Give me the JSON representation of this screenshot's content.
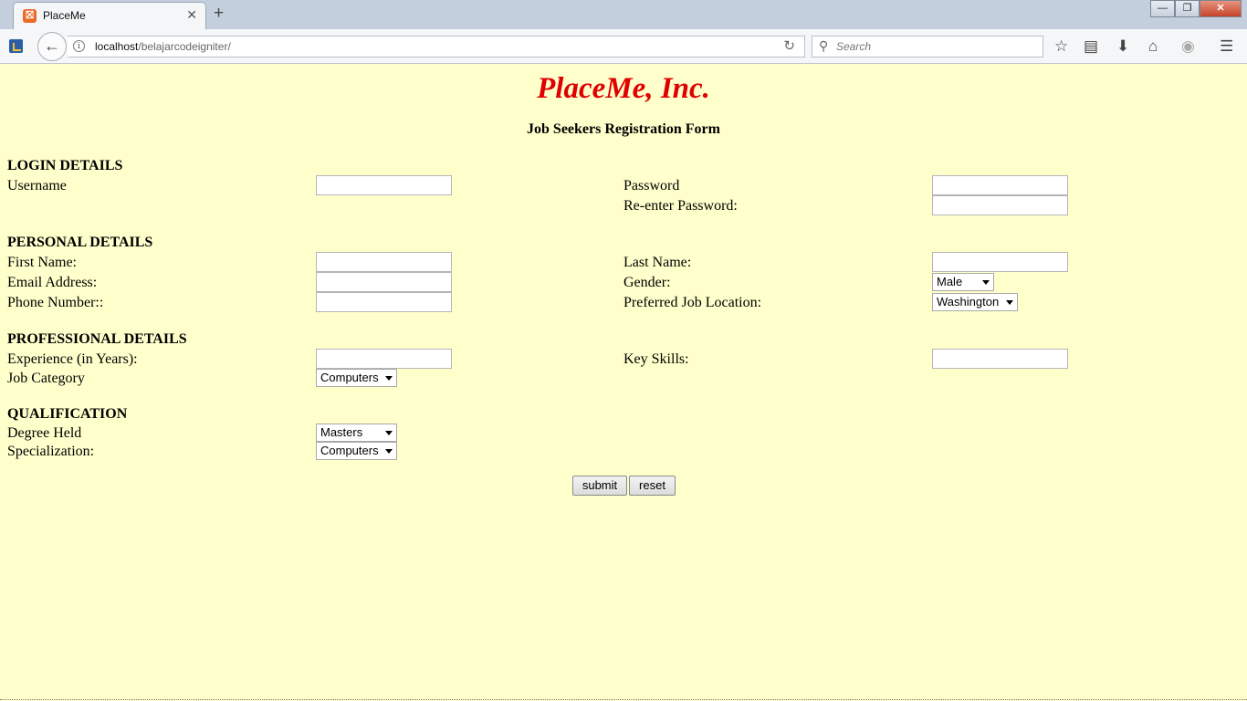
{
  "browser": {
    "tab_title": "PlaceMe",
    "favicon_glyph": "⛝",
    "new_tab_glyph": "+",
    "tab_close_glyph": "✕",
    "url_host": "localhost",
    "url_path": "/belajarcodeigniter/",
    "search_placeholder": "Search",
    "window_controls": [
      "—",
      "❐",
      "✕"
    ],
    "icons": [
      "bookmark-star-icon",
      "reading-list-icon",
      "download-icon",
      "home-icon",
      "sync-icon",
      "menu-icon"
    ]
  },
  "page": {
    "site_title": "PlaceMe, Inc.",
    "form_title": "Job Seekers Registration Form",
    "title_color": "#e00000",
    "background_color": "#ffffcc",
    "sections": {
      "login": "LOGIN DETAILS",
      "personal": "PERSONAL DETAILS",
      "professional": "PROFESSIONAL DETAILS",
      "qualification": "QUALIFICATION"
    },
    "labels": {
      "username": "Username",
      "password": "Password",
      "reenter_password": "Re-enter Password:",
      "first_name": "First Name:",
      "last_name": "Last Name:",
      "email": "Email Address:",
      "gender": "Gender:",
      "phone": "Phone Number::",
      "job_location": "Preferred Job Location:",
      "experience": "Experience (in Years):",
      "key_skills": "Key Skills:",
      "job_category": "Job Category",
      "degree": "Degree Held",
      "specialization": "Specialization:"
    },
    "values": {
      "username": "",
      "password": "",
      "reenter_password": "",
      "first_name": "",
      "last_name": "",
      "email": "",
      "phone": "",
      "experience": "",
      "key_skills": "",
      "gender": "Male",
      "job_location": "Washington",
      "job_category": "Computers",
      "degree": "Masters",
      "specialization": "Computers"
    },
    "buttons": {
      "submit": "submit",
      "reset": "reset"
    }
  }
}
